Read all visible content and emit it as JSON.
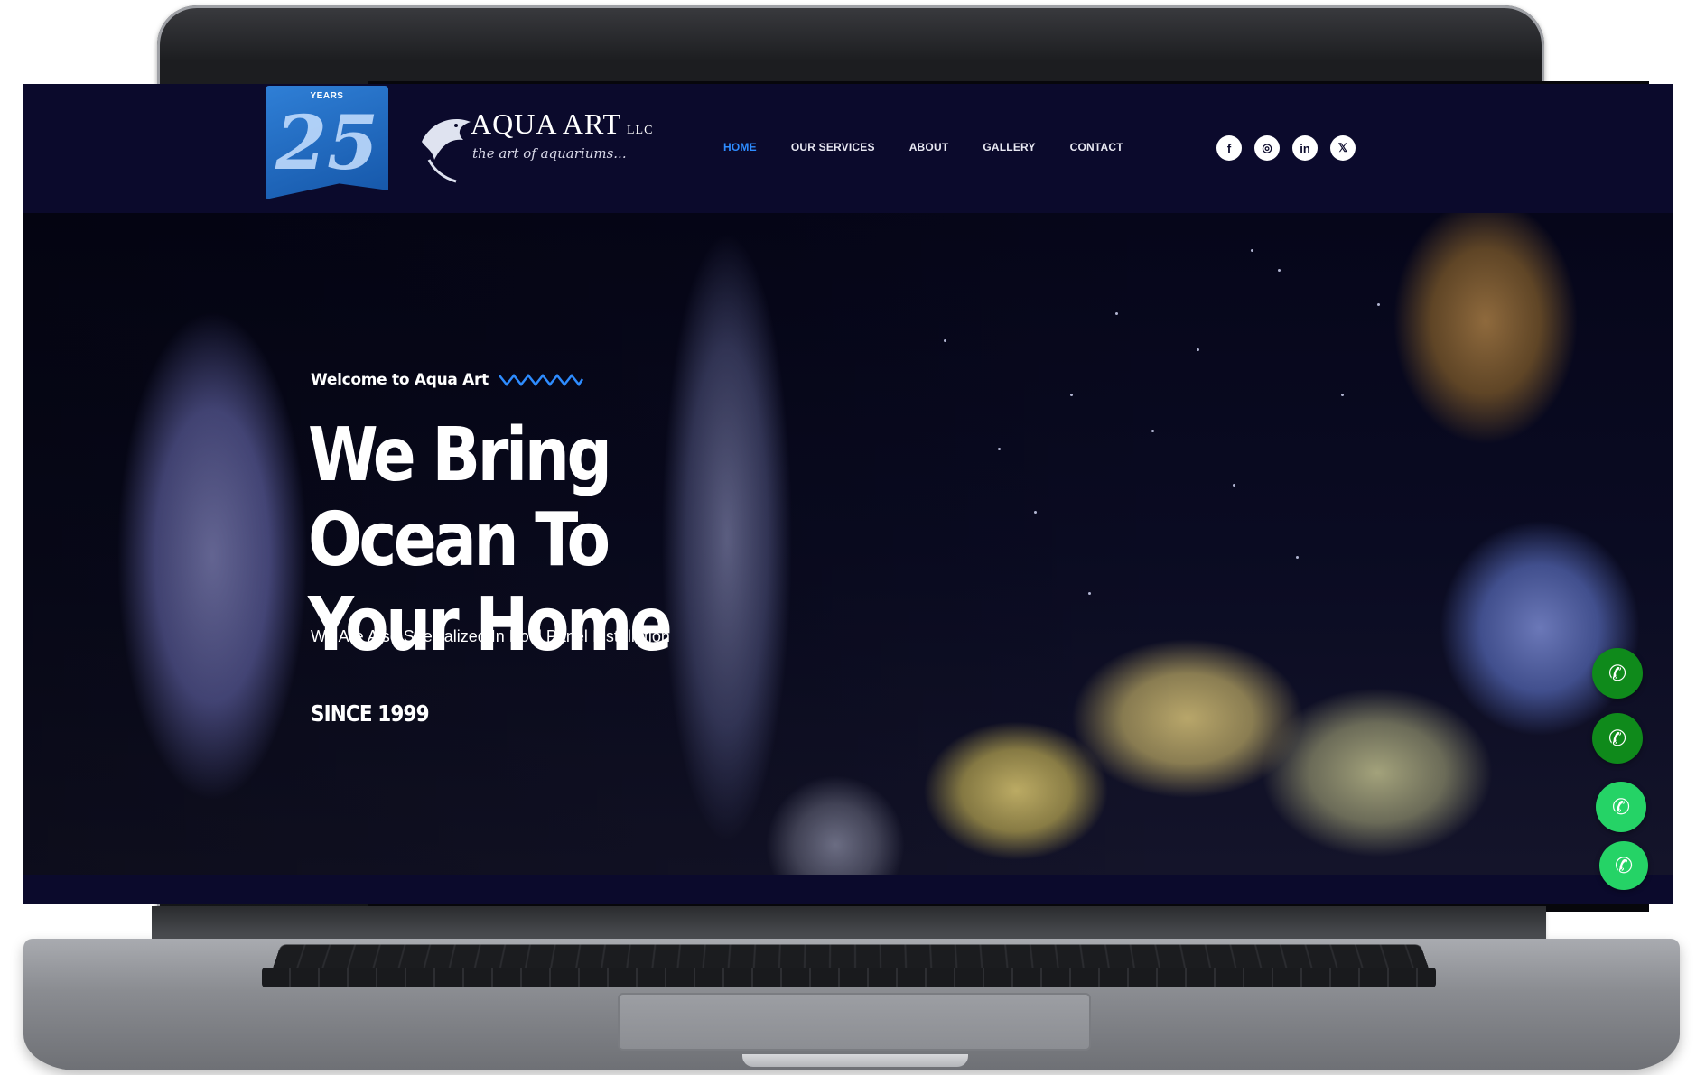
{
  "site": {
    "badge": {
      "top_text": "YEARS",
      "number": "25"
    },
    "logo": {
      "title": "AQUA ART",
      "suffix": "LLC",
      "tagline": "the art of aquariums..."
    },
    "nav": [
      {
        "label": "HOME",
        "active": true
      },
      {
        "label": "OUR SERVICES",
        "active": false
      },
      {
        "label": "ABOUT",
        "active": false
      },
      {
        "label": "GALLERY",
        "active": false
      },
      {
        "label": "CONTACT",
        "active": false
      }
    ],
    "social": [
      "facebook-icon",
      "instagram-icon",
      "linkedin-icon",
      "x-icon"
    ]
  },
  "hero": {
    "welcome": "Welcome to Aqua Art",
    "headline_line1": "We Bring Ocean To",
    "headline_line2": "Your Home",
    "subtitle": "We Are Also Specialized In Pool Panel Installation",
    "since": "SINCE 1999"
  },
  "floating_buttons": [
    "phone-icon",
    "phone-icon",
    "whatsapp-icon",
    "whatsapp-icon"
  ],
  "colors": {
    "navbar_bg": "#0b0a2c",
    "nav_active": "#2e8cff",
    "call_green": "#0f8a1b",
    "whatsapp_green": "#25d366"
  }
}
